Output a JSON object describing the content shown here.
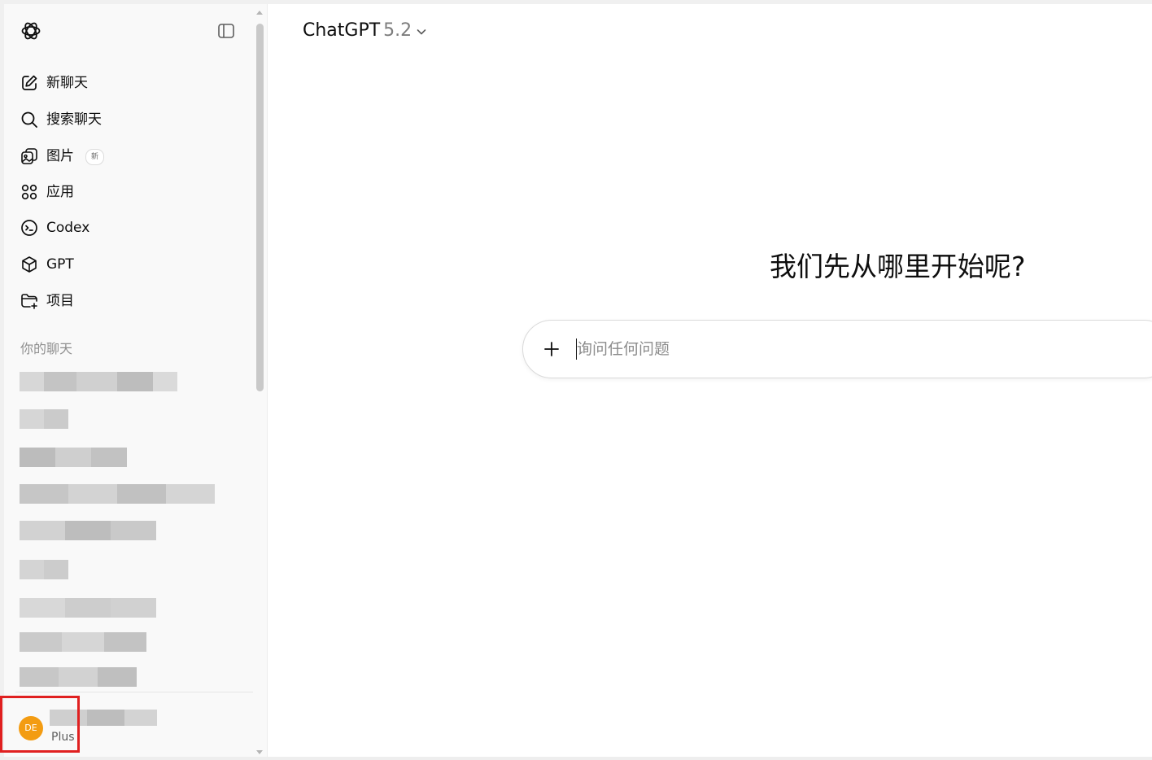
{
  "sidebar": {
    "logo": "openai-logo-icon",
    "toggle": "sidebar-toggle-icon",
    "items": [
      {
        "label": "新聊天",
        "icon": "edit-icon"
      },
      {
        "label": "搜索聊天",
        "icon": "search-icon"
      },
      {
        "label": "图片",
        "icon": "images-icon",
        "badge": "新"
      },
      {
        "label": "应用",
        "icon": "apps-icon"
      },
      {
        "label": "Codex",
        "icon": "codex-icon"
      },
      {
        "label": "GPT",
        "icon": "cube-icon"
      },
      {
        "label": "项目",
        "icon": "folder-plus-icon"
      }
    ],
    "section_title": "你的聊天",
    "profile": {
      "initials": "DE",
      "plan": "Plus"
    }
  },
  "header": {
    "model_name": "ChatGPT",
    "model_version": "5.2"
  },
  "main": {
    "greeting": "我们先从哪里开始呢?"
  },
  "composer": {
    "placeholder": "询问任何问题"
  },
  "colors": {
    "avatar": "#f39c12",
    "highlight": "#e02020",
    "sidebar_bg": "#f9f9f9"
  }
}
